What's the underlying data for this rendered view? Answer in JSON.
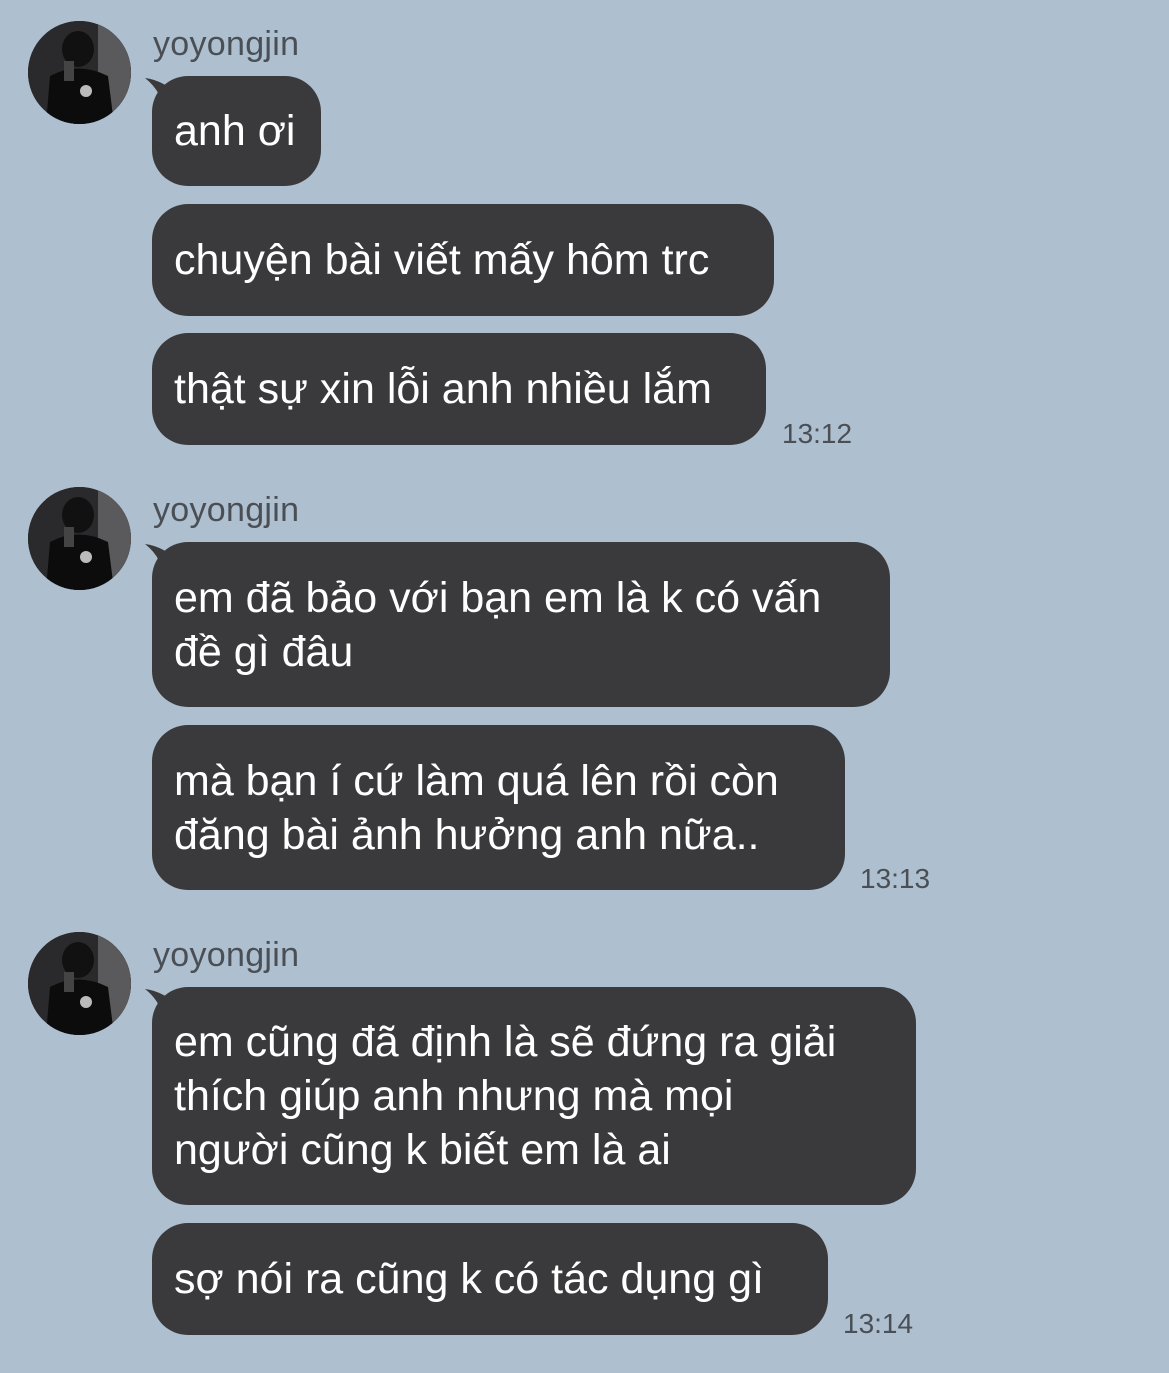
{
  "colors": {
    "background": "#aebfcf",
    "bubble": "#3a3a3c",
    "bubble_text": "#ffffff",
    "meta_text": "#4a4f55"
  },
  "groups": [
    {
      "sender": "yoyongjin",
      "messages": [
        "anh ơi",
        "chuyện bài viết mấy hôm trc",
        "thật sự xin lỗi anh nhiều lắm"
      ],
      "time": "13:12"
    },
    {
      "sender": "yoyongjin",
      "messages": [
        "em đã bảo với bạn em là k có vấn\nđề gì đâu",
        "mà bạn í cứ làm quá lên rồi còn\nđăng bài ảnh hưởng anh nữa.."
      ],
      "time": "13:13"
    },
    {
      "sender": "yoyongjin",
      "messages": [
        "em cũng đã định là sẽ đứng ra giải\nthích giúp anh nhưng mà mọi\nngười cũng k biết em là ai",
        "sợ nói ra cũng k có tác dụng gì"
      ],
      "time": "13:14"
    }
  ]
}
